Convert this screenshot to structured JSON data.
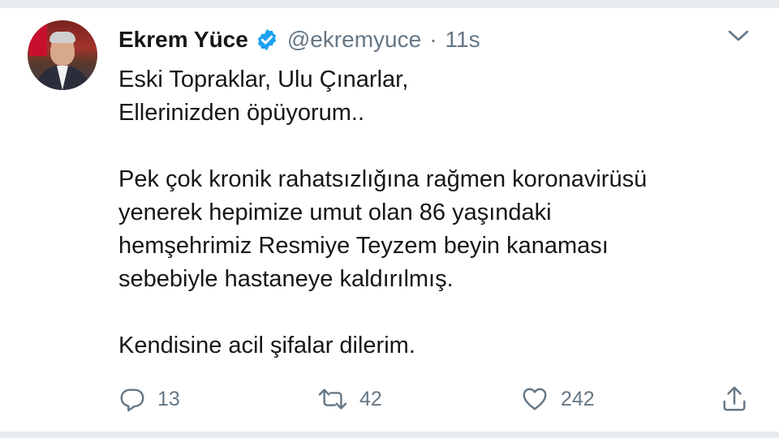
{
  "author": {
    "name": "Ekrem Yüce",
    "handle": "@ekremyuce",
    "separator": "·",
    "time": "11s",
    "verified": true
  },
  "tweet": {
    "lines_block_1": [
      "Eski Topraklar, Ulu Çınarlar,",
      "Ellerinizden öpüyorum.."
    ],
    "lines_block_2": [
      "Pek çok kronik rahatsızlığına rağmen koronavirüsü",
      "yenerek hepimize umut olan 86 yaşındaki",
      "hemşehrimiz Resmiye Teyzem beyin kanaması",
      "sebebiyle hastaneye kaldırılmış."
    ],
    "lines_block_3": [
      "Kendisine acil şifalar dilerim."
    ]
  },
  "actions": {
    "reply_count": "13",
    "retweet_count": "42",
    "like_count": "242"
  },
  "icons": {
    "verified": "verified-badge-icon",
    "menu": "chevron-down-icon",
    "reply": "reply-icon",
    "retweet": "retweet-icon",
    "like": "heart-icon",
    "share": "share-icon"
  },
  "colors": {
    "text": "#14171a",
    "secondary": "#657786",
    "verified": "#1da1f2",
    "divider": "#e6ecf0"
  }
}
